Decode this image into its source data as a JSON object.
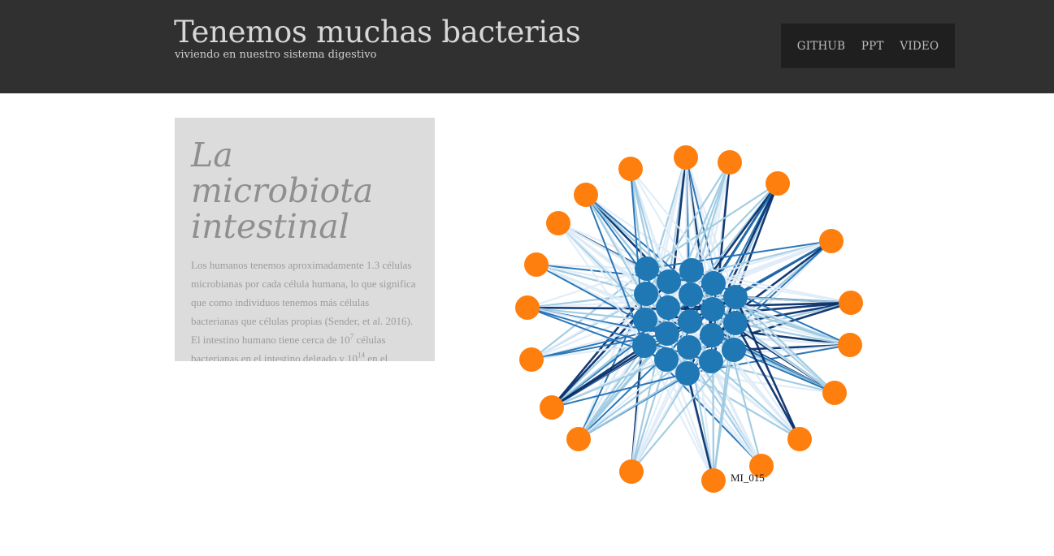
{
  "header": {
    "title": "Tenemos muchas bacterias",
    "subtitle": "viviendo en nuestro sistema digestivo",
    "nav": [
      "GITHUB",
      "PPT",
      "VIDEO"
    ]
  },
  "intro": {
    "heading": "La microbiota intestinal",
    "text_1": "Los humanos tenemos aproximadamente 1.3 células microbianas por cada célula humana, lo que significa que como individuos tenemos más células bacterianas que células propias (Sender, et al. 2016). El intestino humano tiene cerca de 10",
    "sup_1": "7",
    "text_2": " células bacterianas en el intestino delgado y 10",
    "sup_2": "14",
    "text_3": " en el intestino grueso, lo que lleva a pensar en una permanente interacción entre el"
  },
  "network": {
    "hover_label": "MI_015",
    "colors": {
      "outer_node": "#ff7f0e",
      "inner_node": "#1f77b4",
      "link_strong": "#08306b",
      "link_mid": "#2171b5",
      "link_light": "#9ecae1",
      "link_faint": "#deebf7"
    },
    "outer_node_count": 21,
    "inner_node_count": 21
  }
}
